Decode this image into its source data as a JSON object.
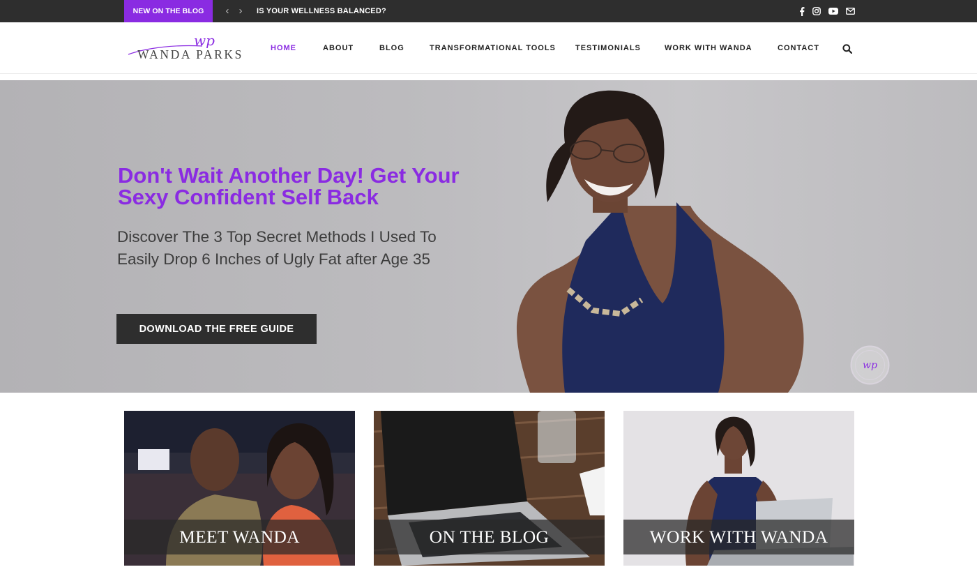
{
  "topbar": {
    "badge": "NEW ON THE BLOG",
    "prev_icon": "chevron-left-icon",
    "next_icon": "chevron-right-icon",
    "headline": "IS YOUR WELLNESS BALANCED?",
    "social_icons": [
      "facebook-icon",
      "instagram-icon",
      "youtube-icon",
      "envelope-icon"
    ]
  },
  "header": {
    "logo": {
      "monogram": "wp",
      "name": "WANDA PARKS"
    },
    "nav": [
      "HOME",
      "ABOUT",
      "BLOG",
      "TRANSFORMATIONAL TOOLS",
      "TESTIMONIALS",
      "WORK WITH WANDA",
      "CONTACT"
    ],
    "active_nav": "HOME",
    "search_icon": "search-icon"
  },
  "hero": {
    "title": "Don't Wait Another Day! Get Your Sexy Confident Self Back",
    "subtitle": "Discover The 3 Top Secret Methods I Used To Easily Drop 6 Inches of Ugly Fat after Age 35",
    "button": "DOWNLOAD THE FREE GUIDE",
    "seal_monogram": "wp"
  },
  "cards": [
    {
      "label": "MEET WANDA"
    },
    {
      "label": "ON THE BLOG"
    },
    {
      "label": "WORK WITH WANDA"
    }
  ],
  "colors": {
    "accent": "#8a2be2",
    "dark": "#2e2e2e",
    "hero_bg": "#bdbcbf"
  }
}
